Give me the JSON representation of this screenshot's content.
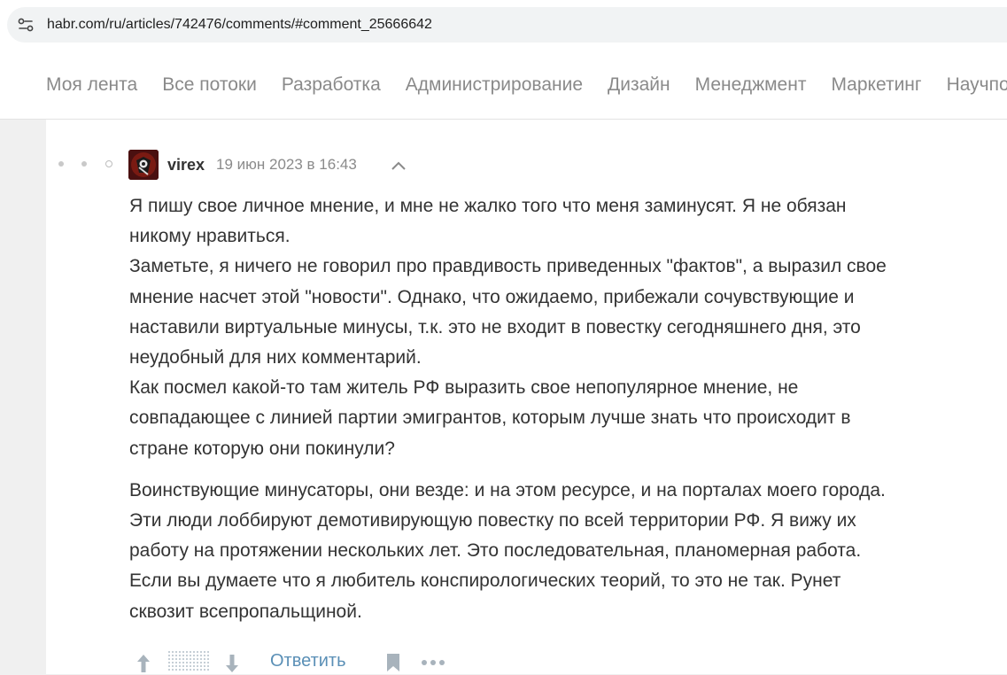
{
  "browser": {
    "url": "habr.com/ru/articles/742476/comments/#comment_25666642",
    "site_info_icon": "tune-icon"
  },
  "nav": {
    "items": [
      {
        "label": "Моя лента"
      },
      {
        "label": "Все потоки"
      },
      {
        "label": "Разработка"
      },
      {
        "label": "Администрирование"
      },
      {
        "label": "Дизайн"
      },
      {
        "label": "Менеджмент"
      },
      {
        "label": "Маркетинг"
      },
      {
        "label": "Научпоп"
      }
    ]
  },
  "comment": {
    "author": "virex",
    "date": "19 июн 2023 в 16:43",
    "paragraphs": [
      "Я пишу свое личное мнение, и мне не жалко того что меня заминусят. Я не обязан\nникому нравиться.\nЗаметьте, я ничего не говорил про правдивость приведенных \"фактов\", а выразил свое\nмнение насчет этой \"новости\". Однако, что ожидаемо, прибежали сочувствующие и\nнаставили виртуальные минусы, т.к. это не входит в повестку сегодняшнего дня, это\nнеудобный для них комментарий.\nКак посмел какой-то там житель РФ выразить свое непопулярное мнение, не\nсовпадающее с линией партии эмигрантов, которым лучше знать что происходит в\nстране которую они покинули?",
      "Воинствующие минусаторы, они везде: и на этом ресурсе, и на порталах моего города.\nЭти люди лоббируют демотивирующую повестку по всей территории РФ. Я вижу их\nработу на протяжении нескольких лет. Это последовательная, планомерная работа.\nЕсли вы думаете что я любитель конспирологических теорий, то это не так. Рунет\nсквозит всепропальщиной."
    ],
    "actions": {
      "reply_label": "Ответить"
    }
  },
  "colors": {
    "nav_text": "#8a8a8a",
    "link": "#5a8fb6",
    "body_text": "#333333",
    "page_bg": "#f0f0f0"
  }
}
